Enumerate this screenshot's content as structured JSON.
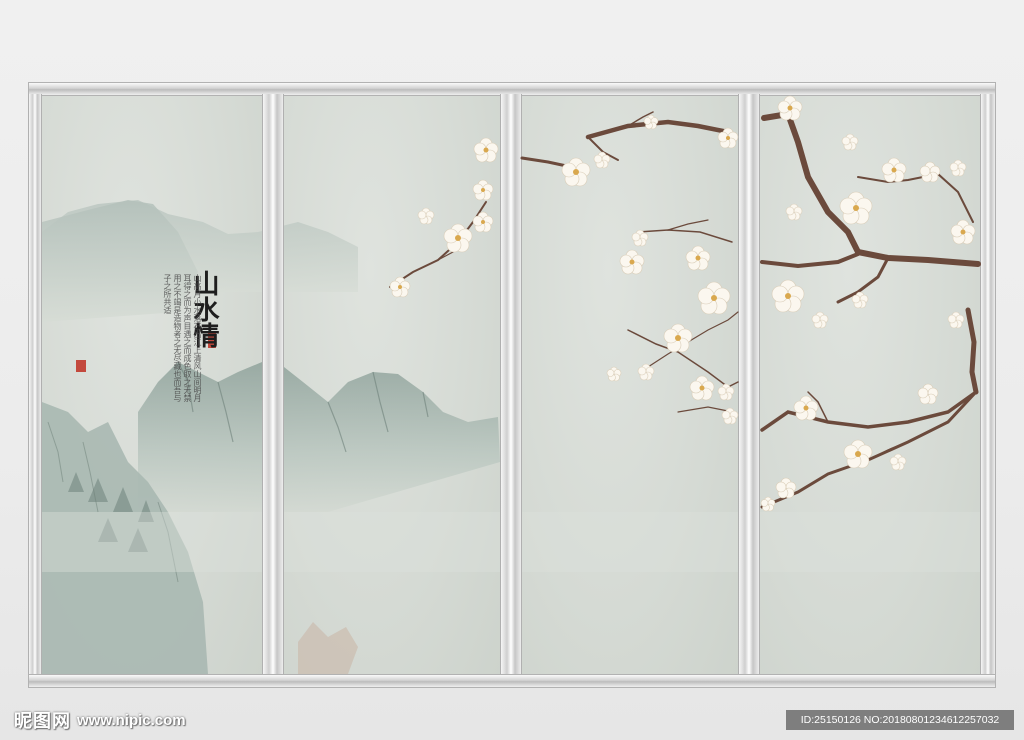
{
  "artwork": {
    "calligraphy_title": "山水情",
    "poem_text": "山高月小水落石出江上清风山间明月耳得之而为声目遇之而成色取之无禁用之不竭是造物者之无尽藏也而吾与子之所共适",
    "seal_text": "印"
  },
  "watermark": {
    "logo": "昵图网",
    "url": "www.nipic.com"
  },
  "id_label": "ID:25150126 NO:20180801234612257032",
  "colors": {
    "panel": "#d8ddd7",
    "rail": "#cfcfcf",
    "branch": "#6b4a3c",
    "blossom": "#fbf7ef",
    "seal": "#c0392b"
  }
}
